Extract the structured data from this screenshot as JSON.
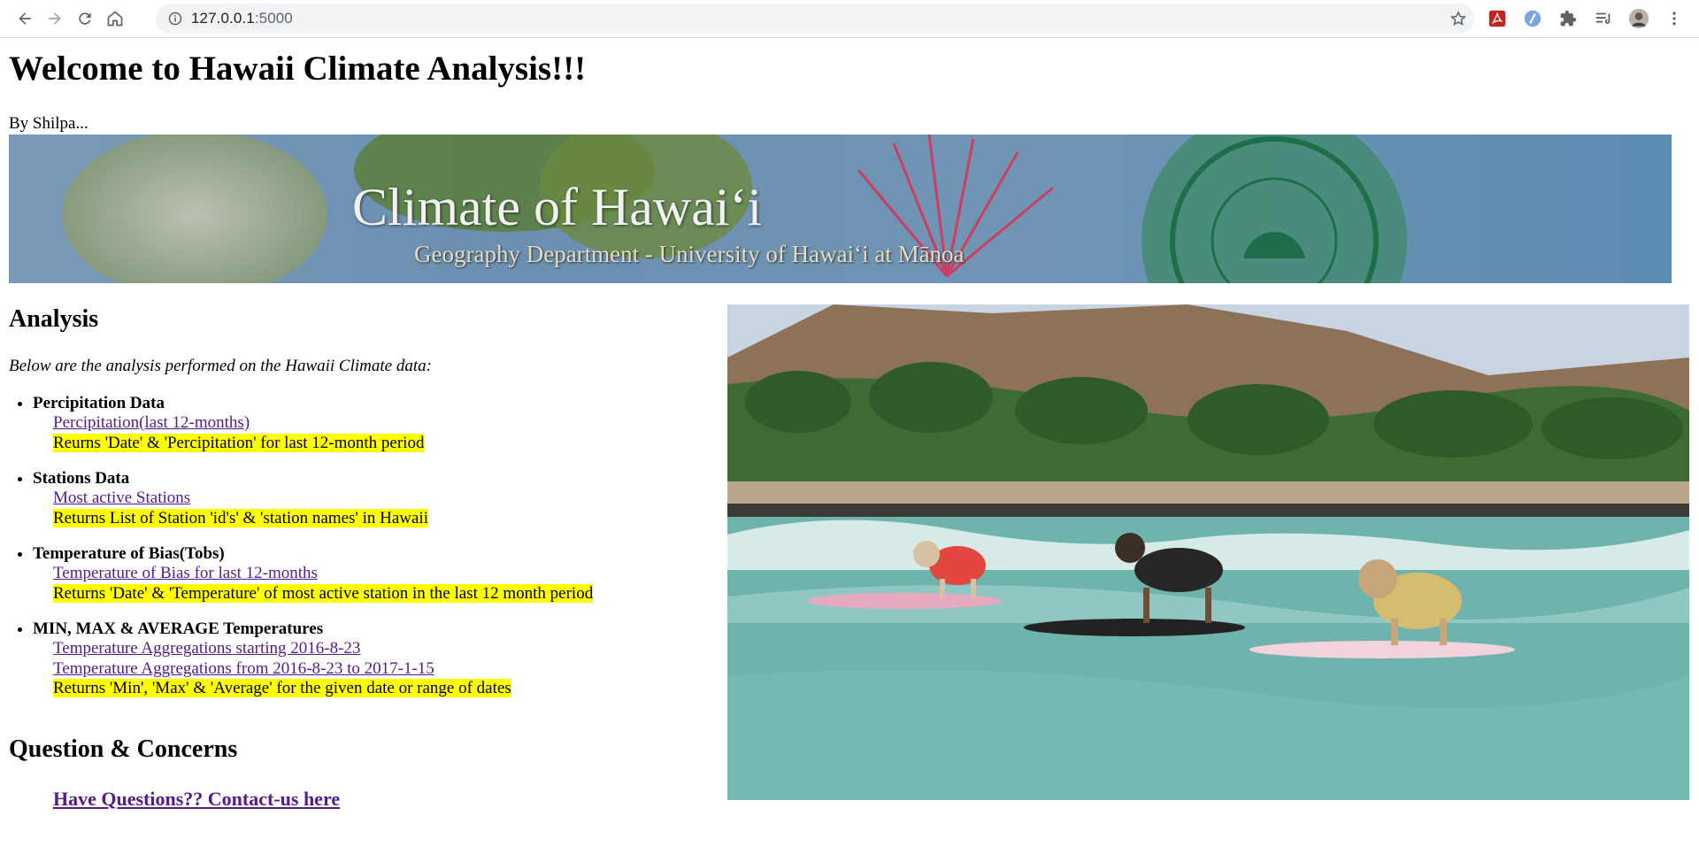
{
  "browser": {
    "url_host": "127.0.0.1",
    "url_port": ":5000",
    "icons": [
      "back-arrow-icon",
      "forward-arrow-icon",
      "reload-icon",
      "home-icon",
      "info-icon",
      "star-icon",
      "pdf-extension-icon",
      "extension-icon",
      "puzzle-icon",
      "reading-list-icon",
      "avatar",
      "kebab-menu-icon"
    ]
  },
  "page": {
    "title": "Welcome to Hawaii Climate Analysis!!!",
    "byline": "By Shilpa...",
    "banner": {
      "title": "Climate of Hawaiʻi",
      "subtitle": "Geography Department - University of Hawaiʻi at Mānoa"
    },
    "analysis_heading": "Analysis",
    "intro": "Below are the analysis performed on the Hawaii Climate data:",
    "sections": [
      {
        "title": "Percipitation Data",
        "links": [
          "Percipitation(last 12-months)"
        ],
        "note": "Reurns 'Date' & 'Percipitation' for last 12-month period"
      },
      {
        "title": "Stations Data",
        "links": [
          "Most active Stations"
        ],
        "note": "Returns List of Station 'id's' & 'station names' in Hawaii"
      },
      {
        "title": "Temperature of Bias(Tobs)",
        "links": [
          "Temperature of Bias for last 12-months"
        ],
        "note": "Returns 'Date' & 'Temperature' of most active station in the last 12 month period"
      },
      {
        "title": "MIN, MAX & AVERAGE Temperatures",
        "links": [
          "Temperature Aggregations starting 2016-8-23",
          "Temperature Aggregations from 2016-8-23 to 2017-1-15"
        ],
        "note": "Returns 'Min', 'Max' & 'Average' for the given date or range of dates"
      }
    ],
    "questions_heading": "Question & Concerns",
    "contact_link": "Have Questions?? Contact-us here"
  },
  "colors": {
    "link_visited": "#551a8b",
    "highlight": "#ffff00"
  }
}
